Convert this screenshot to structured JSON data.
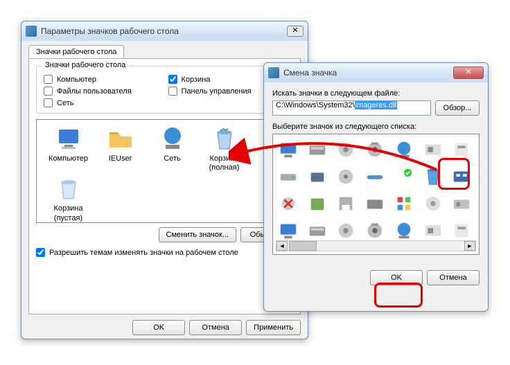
{
  "win1": {
    "title": "Параметры значков рабочего стола",
    "tab": "Значки рабочего стола",
    "group_legend": "Значки рабочего стола",
    "checks": {
      "computer": "Компьютер",
      "userfiles": "Файлы пользователя",
      "network": "Сеть",
      "recycle": "Корзина",
      "ctrlpanel": "Панель управления"
    },
    "icons": [
      {
        "name": "computer",
        "label": "Компьютер"
      },
      {
        "name": "ieuser",
        "label": "IEUser"
      },
      {
        "name": "network",
        "label": "Сеть"
      },
      {
        "name": "bin-full",
        "label": "Корзина (полная)"
      },
      {
        "name": "bin-empty",
        "label": "Корзина (пустая)"
      }
    ],
    "change_icon_btn": "Сменить значок...",
    "default_btn": "Обычный",
    "allow_themes": "Разрешить темам изменять значки на рабочем столе",
    "ok": "OK",
    "cancel": "Отмена",
    "apply": "Применить"
  },
  "win2": {
    "title": "Смена значка",
    "search_label": "Искать значки в следующем файле:",
    "path_prefix": "C:\\Windows\\System32\\",
    "path_selected": "imageres.dll",
    "browse": "Обзор...",
    "pick_label": "Выберите значок из следующего списка:",
    "ok": "OK",
    "cancel": "Отмена"
  }
}
